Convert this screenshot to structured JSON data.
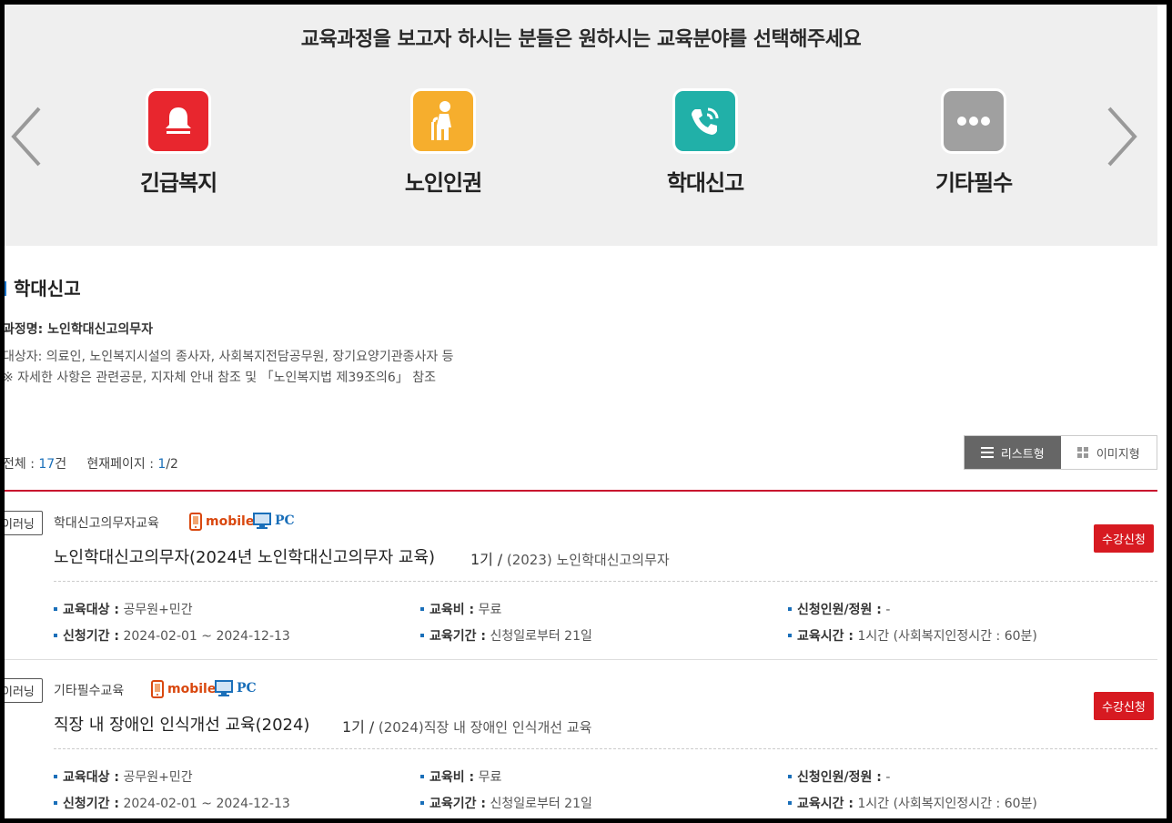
{
  "banner": {
    "title": "교육과정을 보고자 하시는 분들은 원하시는 교육분야를 선택해주세요",
    "categories": [
      {
        "label": "긴급복지",
        "icon": "bell-icon",
        "color": "#e8262e"
      },
      {
        "label": "노인인권",
        "icon": "elderly-person-icon",
        "color": "#f6ae2d"
      },
      {
        "label": "학대신고",
        "icon": "phone-call-icon",
        "color": "#21b0a8"
      },
      {
        "label": "기타필수",
        "icon": "more-dots-icon",
        "color": "#a0a0a0"
      }
    ]
  },
  "section": {
    "title": "학대신고",
    "course_name": "과정명: 노인학대신고의무자",
    "target_line": "대상자: 의료인, 노인복지시설의 종사자, 사회복지전담공무원, 장기요양기관종사자 등",
    "note_line": "※ 자세한 사항은 관련공문, 지자체 안내 참조 및 「노인복지법 제39조의6」 참조"
  },
  "summary": {
    "total_label": "전체 : ",
    "total_count": "17",
    "total_unit": "건",
    "page_label": "현재페이지 : ",
    "page_current": "1",
    "page_total": "/2"
  },
  "view_toggle": {
    "list_label": "리스트형",
    "image_label": "이미지형"
  },
  "colors": {
    "accent_red": "#d71a21",
    "link_blue": "#1a6fb9",
    "divider_red": "#c8102e"
  },
  "courses": [
    {
      "tag": "이러닝",
      "category": "학대신고의무자교육",
      "mobile": "mobile",
      "pc": "PC",
      "apply": "수강신청",
      "title": "노인학대신고의무자(2024년 노인학대신고의무자 교육)",
      "term": "1기",
      "term_sep": "/",
      "term_name": "(2023) 노인학대신고의무자",
      "target_label": "교육대상 :",
      "target": "공무원+민간",
      "fee_label": "교육비 :",
      "fee": "무료",
      "quota_label": "신청인원/정원 :",
      "quota": "-",
      "apply_period_label": "신청기간 :",
      "apply_period": "2024-02-01 ~ 2024-12-13",
      "edu_period_label": "교육기간 :",
      "edu_period": "신청일로부터 21일",
      "hours_label": "교육시간 :",
      "hours": "1시간 (사회복지인정시간 : 60분)"
    },
    {
      "tag": "이러닝",
      "category": "기타필수교육",
      "mobile": "mobile",
      "pc": "PC",
      "apply": "수강신청",
      "title": "직장 내 장애인 인식개선 교육(2024)",
      "term": "1기",
      "term_sep": "/",
      "term_name": "(2024)직장 내 장애인 인식개선 교육",
      "target_label": "교육대상 :",
      "target": "공무원+민간",
      "fee_label": "교육비 :",
      "fee": "무료",
      "quota_label": "신청인원/정원 :",
      "quota": "-",
      "apply_period_label": "신청기간 :",
      "apply_period": "2024-02-01 ~ 2024-12-13",
      "edu_period_label": "교육기간 :",
      "edu_period": "신청일로부터 21일",
      "hours_label": "교육시간 :",
      "hours": "1시간 (사회복지인정시간 : 60분)"
    }
  ]
}
